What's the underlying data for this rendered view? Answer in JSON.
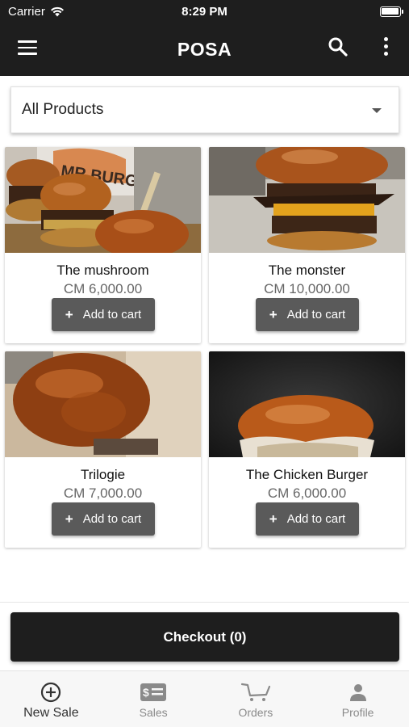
{
  "status_bar": {
    "carrier": "Carrier",
    "time": "8:29 PM"
  },
  "app_bar": {
    "title": "POSA"
  },
  "filter": {
    "selected": "All Products"
  },
  "products": [
    {
      "name": "The mushroom",
      "price": "CM 6,000.00",
      "add_label": "Add to cart"
    },
    {
      "name": "The monster",
      "price": "CM 10,000.00",
      "add_label": "Add to cart"
    },
    {
      "name": "Trilogie",
      "price": "CM 7,000.00",
      "add_label": "Add to cart"
    },
    {
      "name": "The Chicken Burger",
      "price": "CM 6,000.00",
      "add_label": "Add to cart"
    }
  ],
  "checkout": {
    "label": "Checkout (0)"
  },
  "bottom_nav": {
    "items": [
      {
        "label": "New Sale",
        "icon": "plus-circle-icon"
      },
      {
        "label": "Sales",
        "icon": "receipt-icon"
      },
      {
        "label": "Orders",
        "icon": "cart-icon"
      },
      {
        "label": "Profile",
        "icon": "person-icon"
      }
    ]
  },
  "colors": {
    "bar": "#1e1e1e",
    "button": "#5a5a5a",
    "nav_bg": "#f7f7f7"
  }
}
